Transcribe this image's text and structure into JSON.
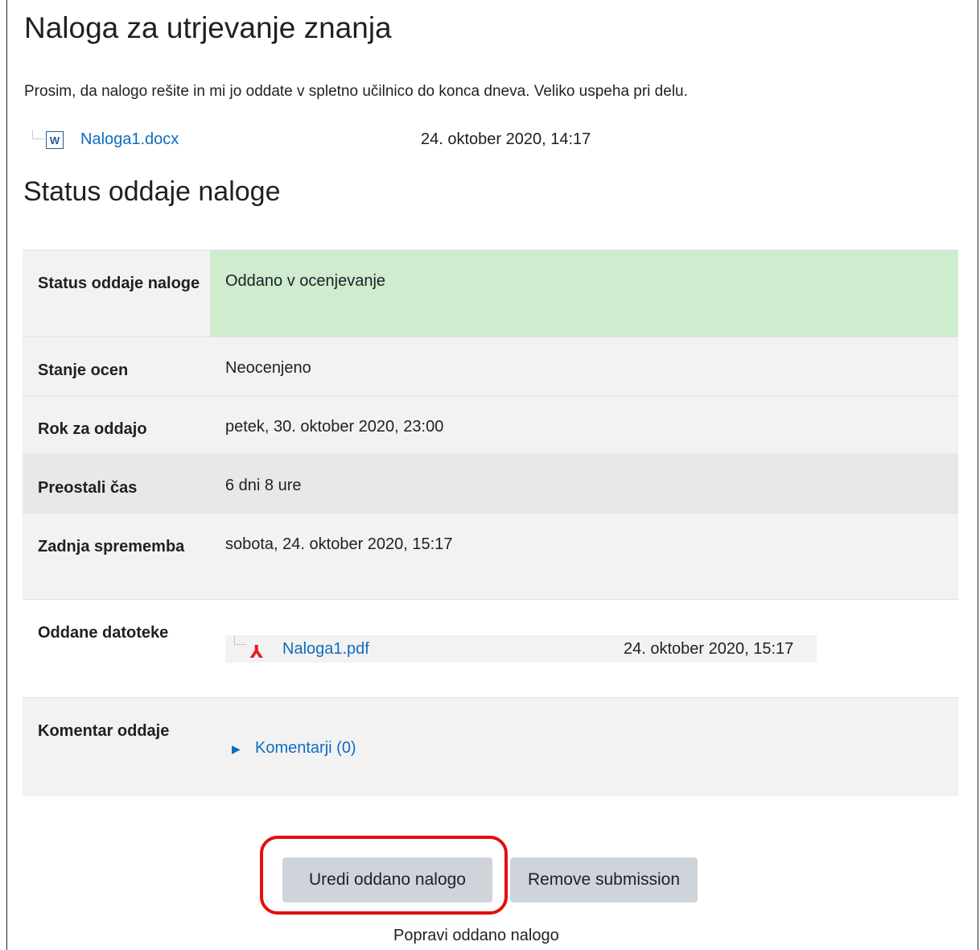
{
  "page": {
    "title": "Naloga za utrjevanje znanja",
    "intro": "Prosim, da nalogo rešite in mi jo oddate v spletno učilnico do konca dneva. Veliko uspeha pri delu."
  },
  "attachment": {
    "icon": "word-document-icon",
    "name": "Naloga1.docx",
    "date": "24. oktober 2020, 14:17"
  },
  "submission": {
    "section_title": "Status oddaje naloge",
    "rows": [
      {
        "label": "Status oddaje naloge",
        "value": "Oddano v ocenjevanje"
      },
      {
        "label": "Stanje ocen",
        "value": "Neocenjeno"
      },
      {
        "label": "Rok za oddajo",
        "value": "petek, 30. oktober 2020, 23:00"
      },
      {
        "label": "Preostali čas",
        "value": "6 dni 8 ure"
      },
      {
        "label": "Zadnja sprememba",
        "value": "sobota, 24. oktober 2020, 15:17"
      },
      {
        "label": "Oddane datoteke",
        "file_name": "Naloga1.pdf",
        "file_date": "24. oktober 2020, 15:17",
        "file_icon": "pdf-icon"
      },
      {
        "label": "Komentar oddaje",
        "comments_link": "Komentarji (0)"
      }
    ]
  },
  "actions": {
    "edit_button": "Uredi oddano nalogo",
    "remove_button": "Remove submission",
    "caption": "Popravi oddano nalogo"
  },
  "colors": {
    "link": "#0f6cbf",
    "submitted_bg": "#cfeccf",
    "button_bg": "#ced4da",
    "highlight": "#e01010"
  }
}
